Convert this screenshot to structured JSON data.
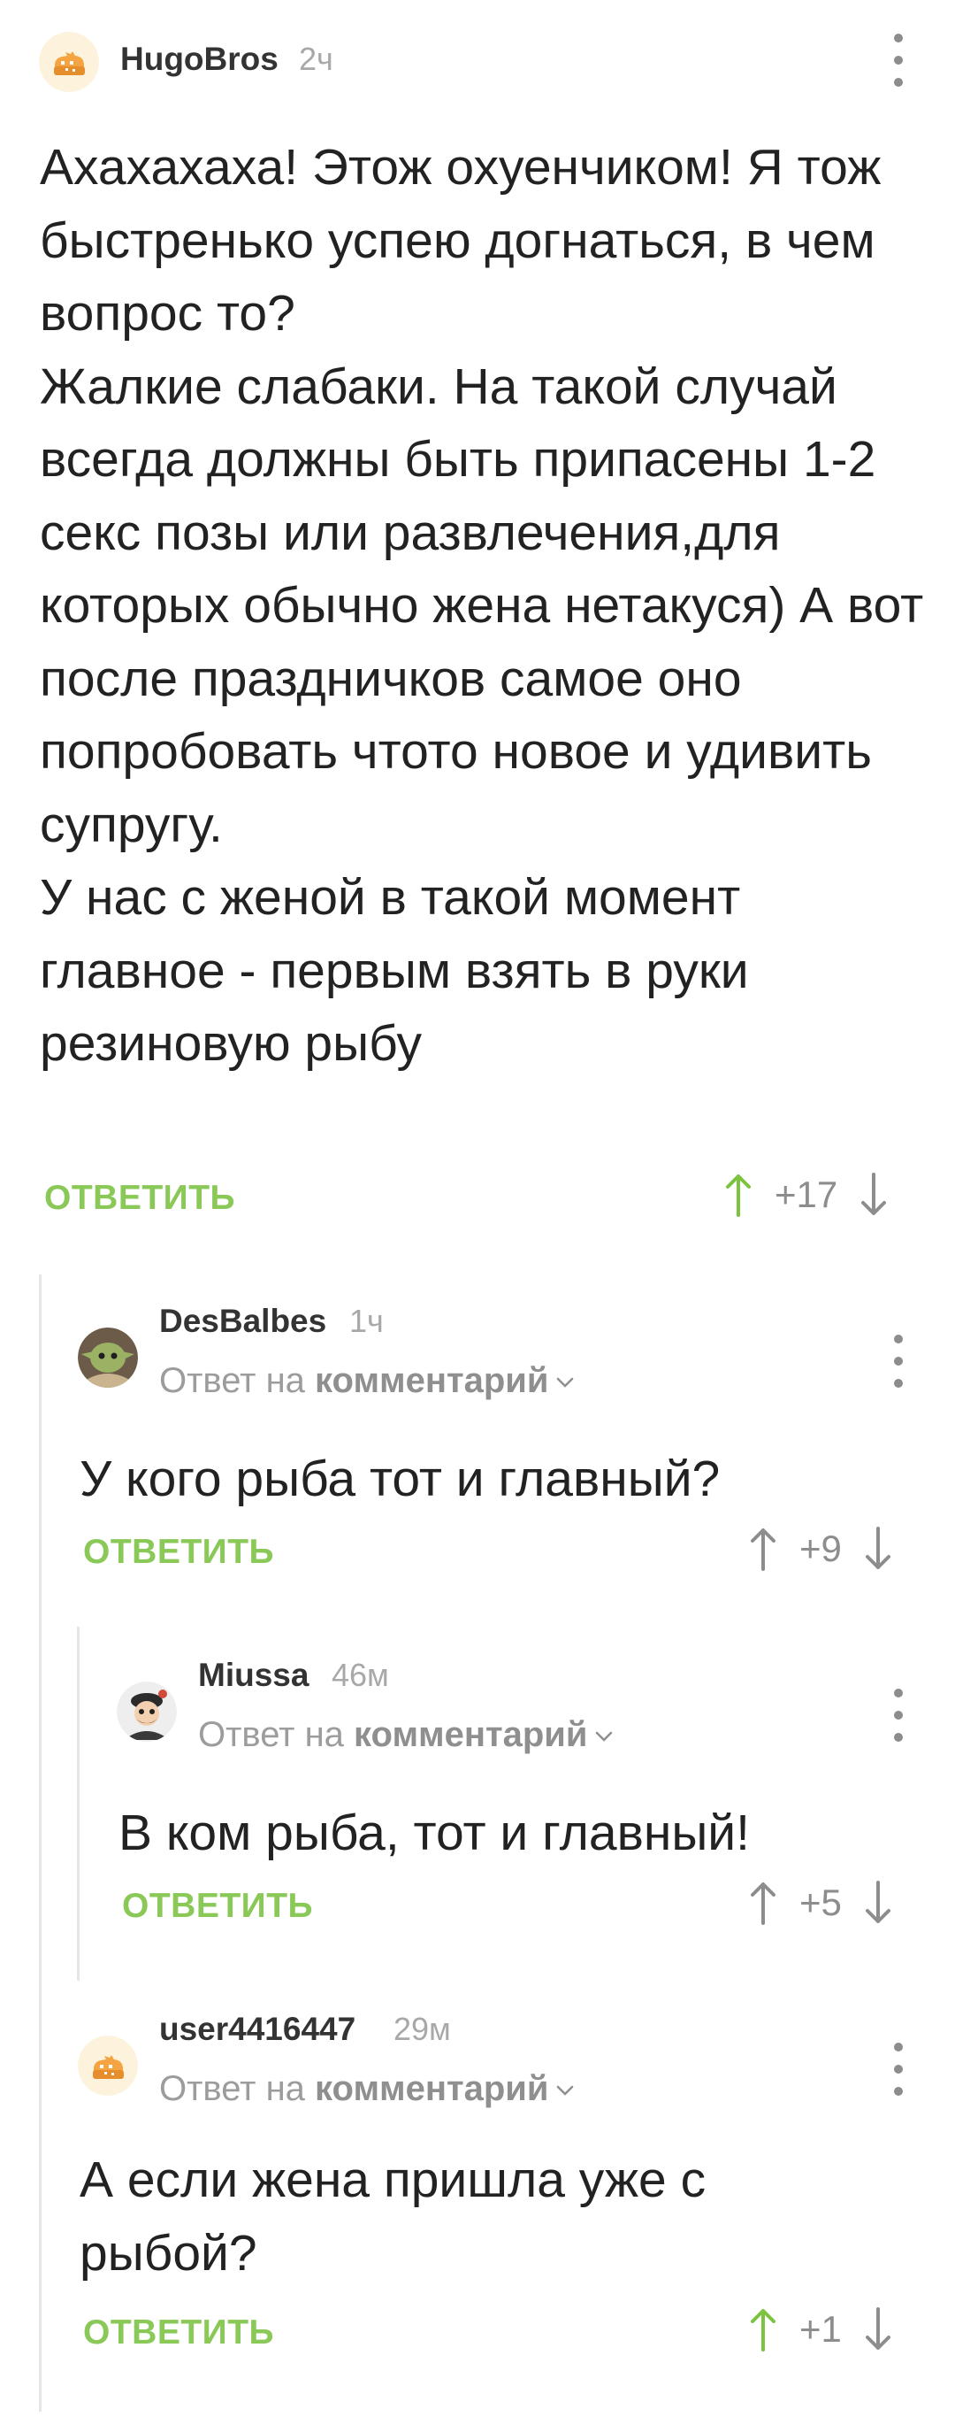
{
  "comments": [
    {
      "author": "HugoBros",
      "time": "2ч",
      "avatar": "pikabu-default-avatar",
      "text": "Ахахахаха! Этож охуенчиком! Я тож быстренько успею догнаться, в чем вопрос то?\nЖалкие слабаки. На такой случай всегда должны быть припасены 1-2 секс позы или развлечения,для которых обычно жена нетакуся) А вот после праздничков самое оно попробовать чтото новое и удивить супругу.\nУ нас с женой в такой момент главное - первым взять в руки резиновую рыбу",
      "reply_label": "ОТВЕТИТЬ",
      "score": "+17",
      "upvoted": true
    },
    {
      "author": "DesBalbes",
      "time": "1ч",
      "avatar": "yoda-avatar",
      "reply_prefix": "Ответ на",
      "reply_link": "комментарий",
      "text": "У кого рыба тот и главный?",
      "reply_label": "ОТВЕТИТЬ",
      "score": "+9",
      "upvoted": false
    },
    {
      "author": "Miussa",
      "time": "46м",
      "avatar": "cartoon-avatar",
      "reply_prefix": "Ответ на",
      "reply_link": "комментарий",
      "text": "В ком рыба, тот и главный!",
      "reply_label": "ОТВЕТИТЬ",
      "score": "+5",
      "upvoted": false
    },
    {
      "author": "user4416447",
      "time": "29м",
      "avatar": "pikabu-default-avatar",
      "reply_prefix": "Ответ на",
      "reply_link": "комментарий",
      "text": "А если жена пришла уже с рыбой?",
      "reply_label": "ОТВЕТИТЬ",
      "score": "+1",
      "upvoted": true
    }
  ],
  "colors": {
    "reply_green": "#8ac858",
    "upvote_green": "#7cc33f",
    "neutral_grey": "#8d8d8d"
  }
}
